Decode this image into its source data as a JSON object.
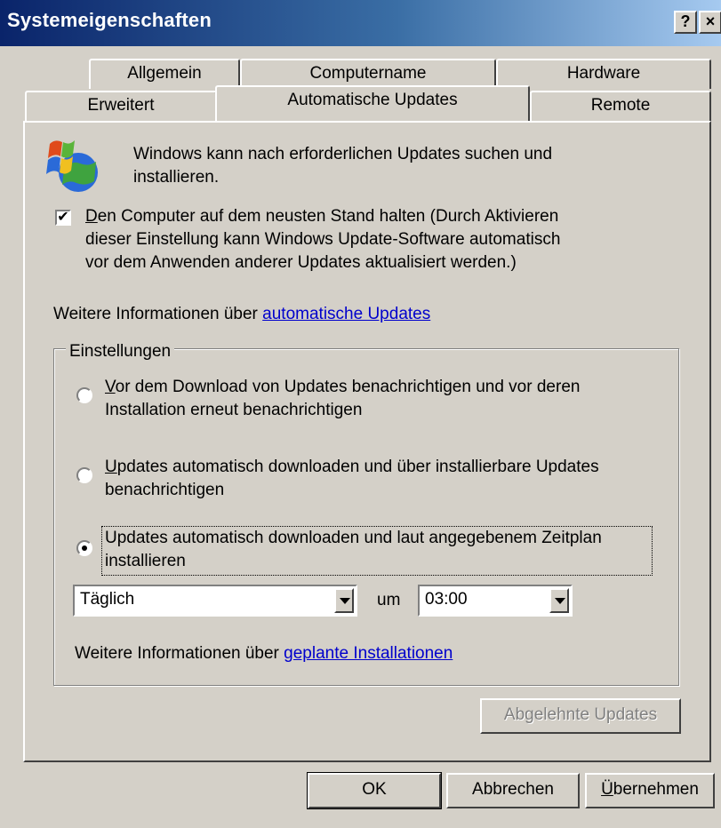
{
  "window": {
    "title": "Systemeigenschaften",
    "help_label": "?",
    "close_label": "×"
  },
  "tabs": {
    "row1": [
      "Allgemein",
      "Computername",
      "Hardware"
    ],
    "row2": [
      "Erweitert",
      "Automatische Updates",
      "Remote"
    ],
    "active": "Automatische Updates"
  },
  "main": {
    "intro_line1": "Windows kann nach erforderlichen Updates suchen und",
    "intro_line2": "installieren.",
    "keep_updated": {
      "checked": true,
      "line1_prefix": "",
      "line1_mnemonic": "D",
      "line1_rest": "en Computer auf dem neusten Stand halten (Durch Aktivieren",
      "line2": "dieser Einstellung kann Windows Update-Software automatisch",
      "line3": "vor dem Anwenden anderer Updates aktualisiert werden.)"
    },
    "more_info_prefix": "Weitere Informationen über ",
    "more_info_link": "automatische Updates"
  },
  "settings": {
    "legend": "Einstellungen",
    "options": [
      {
        "mnemonic": "V",
        "line1_rest": "or dem Download von Updates benachrichtigen und vor deren",
        "line2": "Installation erneut benachrichtigen",
        "selected": false
      },
      {
        "line1_pre": "",
        "mnemonic": "U",
        "line1_rest": "pdates automatisch downloaden und über installierbare Updates",
        "line2": "benachrichtigen",
        "selected": false
      },
      {
        "line1_pre": "Updates automatisch downloaden und laut angegebenem Zeitplan",
        "line2": "installieren",
        "selected": true
      }
    ],
    "schedule_day": "Täglich",
    "at_label": "um",
    "schedule_time": "03:00",
    "scheduled_info_prefix": "Weitere Informationen über ",
    "scheduled_info_link": "geplante Installationen"
  },
  "declined_button": "Abgelehnte Updates",
  "footer": {
    "ok": "OK",
    "cancel": "Abbrechen",
    "apply_mnemonic": "Ü",
    "apply_rest": "bernehmen"
  }
}
